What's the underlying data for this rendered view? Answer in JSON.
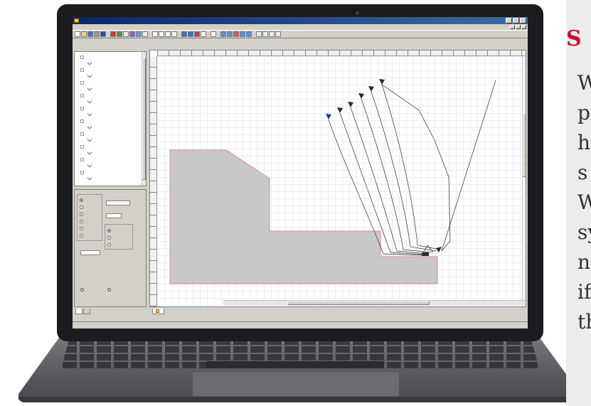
{
  "window": {
    "title": ""
  },
  "menu": [],
  "tree": {
    "items": [
      {
        "type": "parent",
        "label": ""
      },
      {
        "type": "child",
        "label": ""
      },
      {
        "type": "parent",
        "label": ""
      },
      {
        "type": "child",
        "label": ""
      },
      {
        "type": "parent",
        "label": ""
      },
      {
        "type": "child",
        "label": ""
      },
      {
        "type": "parent",
        "label": ""
      },
      {
        "type": "child",
        "label": ""
      },
      {
        "type": "parent",
        "label": ""
      },
      {
        "type": "child",
        "label": ""
      },
      {
        "type": "parent",
        "label": ""
      },
      {
        "type": "child",
        "label": ""
      },
      {
        "type": "parent",
        "label": ""
      },
      {
        "type": "child",
        "label": ""
      },
      {
        "type": "parent",
        "label": ""
      },
      {
        "type": "child",
        "label": ""
      },
      {
        "type": "parent",
        "label": ""
      },
      {
        "type": "child",
        "label": ""
      },
      {
        "type": "parent",
        "label": ""
      },
      {
        "type": "child",
        "label": "",
        "selected": true
      }
    ]
  },
  "settings": {
    "group_tool_caption": "",
    "tool_options": [
      {
        "label": "",
        "checked": true
      },
      {
        "label": "",
        "checked": false
      },
      {
        "label": "",
        "checked": false
      },
      {
        "label": "",
        "checked": false
      },
      {
        "label": "",
        "checked": false
      },
      {
        "label": "",
        "checked": false
      }
    ],
    "parameter_label": "",
    "parameter_value": "",
    "spindle_label": "",
    "spindle_value": "",
    "compensation_label": "",
    "compensation_options": [
      {
        "label": "",
        "checked": true
      },
      {
        "label": "",
        "checked": false
      },
      {
        "label": "",
        "checked": false
      }
    ],
    "radius_label": "",
    "radius_value": "",
    "x_readout": "",
    "z_readout": ""
  },
  "panel_tabs": [
    "",
    ""
  ],
  "document_tab": "",
  "status": {
    "left": "",
    "right": ""
  },
  "side_panel": {
    "heading": "S",
    "lines": [
      "W",
      "p",
      "h",
      "s",
      "W",
      "sy",
      "n",
      "if",
      "th"
    ]
  },
  "colors": {
    "part_fill": "#c8c8c8",
    "part_outline": "#e08a8a",
    "toolpath": "#2a2a2a",
    "tool_marker": "#1f3a99",
    "heading": "#c8102e",
    "titlebar": "#0a246a"
  }
}
